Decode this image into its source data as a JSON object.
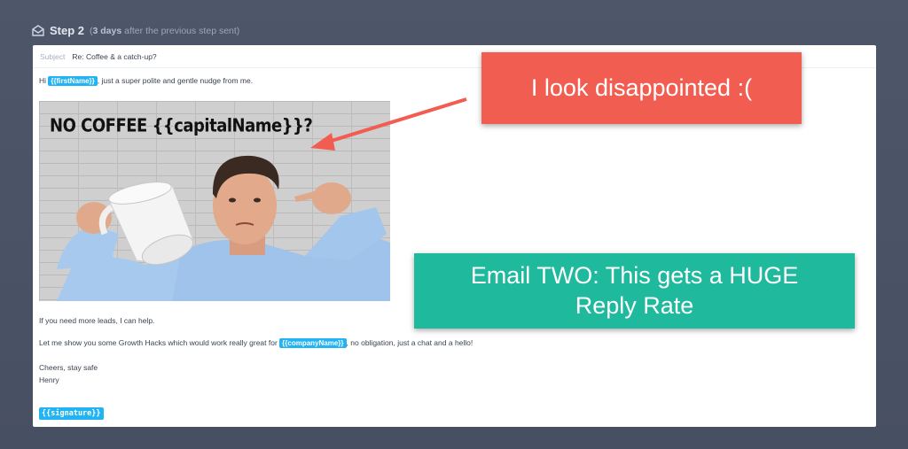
{
  "step": {
    "title": "Step 2",
    "delay_open": "(",
    "delay_days": "3 days",
    "delay_rest": " after the previous step sent)"
  },
  "email": {
    "subject_label": "Subject",
    "subject_value": "Re: Coffee & a catch-up?",
    "greeting_prefix": "Hi ",
    "first_name_var": "{{firstName}}",
    "greeting_suffix": ", just a super polite and gentle nudge from me.",
    "image_text": "NO COFFEE {{capitalName}}?",
    "line_leads": "If you need more leads, I can help.",
    "line_hacks_prefix": "Let me show you some Growth Hacks which would work really great for ",
    "company_var": "{{companyName}}",
    "line_hacks_suffix": ", no obligation, just a chat and a hello!",
    "closing": "Cheers, stay safe",
    "name": "Henry",
    "signature_var": "{{signature}}"
  },
  "callouts": {
    "red_text": "I look disappointed :(",
    "green_line1": "Email TWO: This gets a HUGE",
    "green_line2": "Reply Rate"
  },
  "colors": {
    "background": "#4d5769",
    "variable_chip": "#21b3f2",
    "red_callout": "#f25d52",
    "green_callout": "#1fb99e"
  },
  "icons": {
    "step_icon": "envelope-open-icon"
  }
}
